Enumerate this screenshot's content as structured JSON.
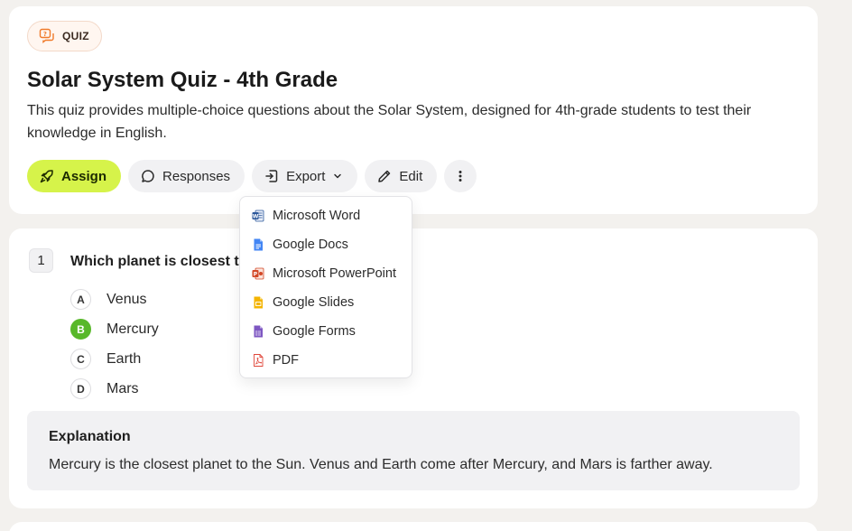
{
  "header": {
    "badge_label": "QUIZ",
    "title": "Solar System Quiz - 4th Grade",
    "description": "This quiz provides multiple-choice questions about the Solar System, designed for 4th-grade students to test their knowledge in English."
  },
  "actions": {
    "assign_label": "Assign",
    "responses_label": "Responses",
    "export_label": "Export",
    "edit_label": "Edit"
  },
  "export_menu": {
    "items": [
      {
        "label": "Microsoft Word",
        "icon": "word-icon",
        "color": "#2b579a"
      },
      {
        "label": "Google Docs",
        "icon": "google-docs-icon",
        "color": "#4285f4"
      },
      {
        "label": "Microsoft PowerPoint",
        "icon": "powerpoint-icon",
        "color": "#d24726"
      },
      {
        "label": "Google Slides",
        "icon": "google-slides-icon",
        "color": "#f4b400"
      },
      {
        "label": "Google Forms",
        "icon": "google-forms-icon",
        "color": "#7e57c2"
      },
      {
        "label": "PDF",
        "icon": "pdf-icon",
        "color": "#e0463a"
      }
    ]
  },
  "question": {
    "number": "1",
    "text": "Which planet is closest t",
    "options": [
      {
        "letter": "A",
        "text": "Venus",
        "correct": false
      },
      {
        "letter": "B",
        "text": "Mercury",
        "correct": true
      },
      {
        "letter": "C",
        "text": "Earth",
        "correct": false
      },
      {
        "letter": "D",
        "text": "Mars",
        "correct": false
      }
    ],
    "explanation_title": "Explanation",
    "explanation_text": "Mercury is the closest planet to the Sun. Venus and Earth come after Mercury, and Mars is farther away."
  },
  "colors": {
    "accent": "#d6f34a",
    "correct": "#58b82a",
    "badge_orange": "#f07a2a"
  }
}
